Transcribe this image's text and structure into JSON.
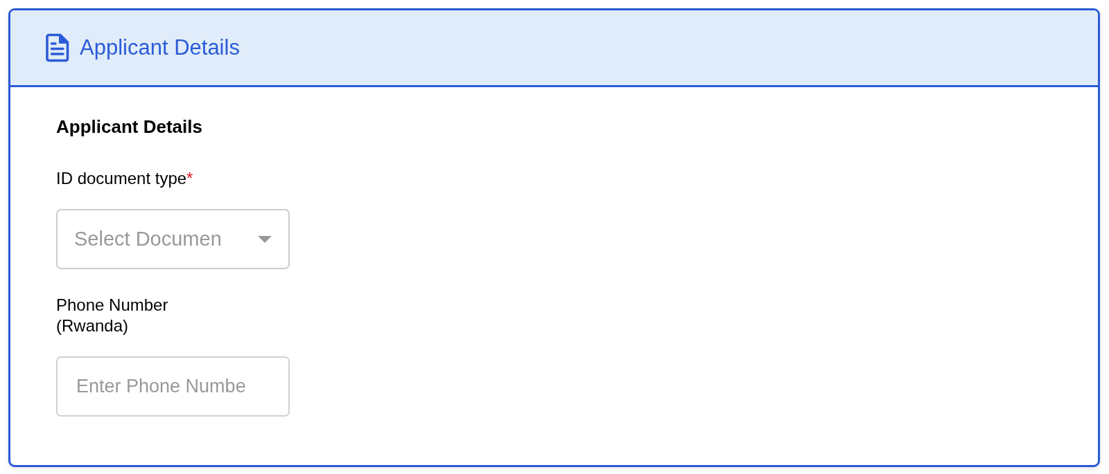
{
  "panel": {
    "title": "Applicant Details"
  },
  "section": {
    "heading": "Applicant Details",
    "fields": [
      {
        "kind": "select",
        "label": "ID document type",
        "required_mark": "*",
        "placeholder": "Select Documen"
      },
      {
        "kind": "text",
        "label": "Phone Number (Rwanda)",
        "placeholder": "Enter Phone Numbe"
      }
    ]
  }
}
